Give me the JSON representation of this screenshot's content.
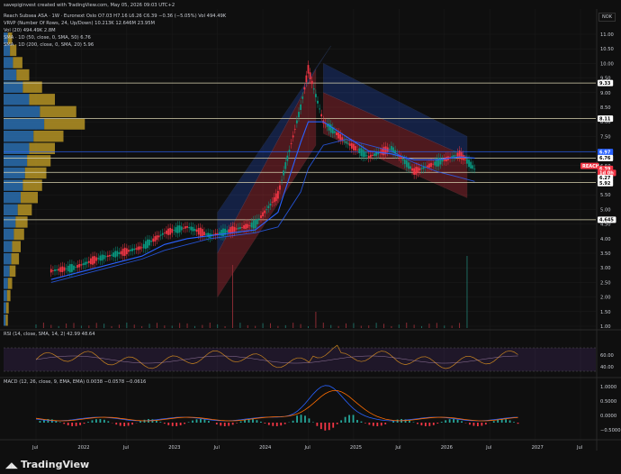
{
  "header": {
    "credit": "savepiginvest created with TradingView.com, May 05, 2026 09:03 UTC+2",
    "line1": "Reach Subsea ASA · 1W · Euronext Oslo  O7.03  H7.16  L6.26  C6.39  −0.36 (−5.05%)  Vol 494.49K",
    "line2": "VRVP (Number Of Rows, 24, Up/Down)  10.213K  12.646M  23.95M",
    "line3": "Vol (20)  494.49K  2.8M",
    "line4": "SMA · 1D (50, close, 0, SMA, 50)  6.76",
    "line5": "SMA · 1D (200, close, 0, SMA, 20)  5.96",
    "currency": "NOK"
  },
  "price_axis_ticks": [
    "11.00",
    "10.50",
    "10.00",
    "9.50",
    "9.00",
    "8.50",
    "8.00",
    "7.50",
    "7.00",
    "6.50",
    "6.00",
    "5.50",
    "5.00",
    "4.50",
    "4.00",
    "3.50",
    "3.00",
    "2.50",
    "2.00",
    "1.50",
    "1.00"
  ],
  "price_labels": [
    {
      "text": "9.33",
      "bg": "#ffffff",
      "fg": "#000000",
      "value": 9.33
    },
    {
      "text": "8.11",
      "bg": "#ffffff",
      "fg": "#000000",
      "value": 8.11
    },
    {
      "text": "6.97",
      "bg": "#2962ff",
      "fg": "#ffffff",
      "value": 6.97
    },
    {
      "text": "6.76",
      "bg": "#ffffff",
      "fg": "#000000",
      "value": 6.76
    },
    {
      "text": "REACH",
      "bg": "#f23645",
      "fg": "#ffffff",
      "value": 6.49
    },
    {
      "text": "6.39",
      "bg": "#f23645",
      "fg": "#ffffff",
      "value": 6.39
    },
    {
      "text": "1d 0h",
      "bg": "#f23645",
      "fg": "#ffffff",
      "value": 6.25
    },
    {
      "text": "6.27",
      "bg": "#ffffff",
      "fg": "#000000",
      "value": 6.08
    },
    {
      "text": "5.92",
      "bg": "#ffffff",
      "fg": "#000000",
      "value": 5.9
    },
    {
      "text": "4.645",
      "bg": "#ffffff",
      "fg": "#000000",
      "value": 4.645
    }
  ],
  "rsi": {
    "title": "RSI (14, close, SMA, 14, 2)  42.99  48.64",
    "ticks": [
      "60.00",
      "40.00"
    ]
  },
  "macd": {
    "title": "MACD (12, 26, close, 9, EMA, EMA)  0.0038  −0.0578  −0.0616",
    "ticks": [
      "1.0000",
      "0.5000",
      "0.0000",
      "−0.5000"
    ]
  },
  "time_axis": [
    "Jul",
    "2022",
    "Jul",
    "2023",
    "Jul",
    "2024",
    "Jul",
    "2025",
    "Jul",
    "2026",
    "Jul",
    "2027",
    "Jul"
  ],
  "footer": {
    "brand": "TradingView"
  },
  "chart_data": {
    "type": "line",
    "series": [
      {
        "name": "Reach Subsea ASA",
        "x": [
          "2021-09",
          "2021-12",
          "2022-03",
          "2022-06",
          "2022-09",
          "2022-12",
          "2023-03",
          "2023-06",
          "2023-09",
          "2023-12",
          "2024-03",
          "2024-06",
          "2024-07",
          "2024-09",
          "2024-12",
          "2025-03",
          "2025-06",
          "2025-09",
          "2025-12",
          "2026-03",
          "2026-05"
        ],
        "y": [
          2.9,
          3.0,
          3.3,
          3.5,
          3.7,
          4.2,
          4.4,
          4.1,
          4.3,
          4.5,
          5.5,
          8.5,
          9.8,
          8.0,
          7.3,
          6.8,
          7.1,
          6.3,
          6.6,
          6.9,
          6.39
        ]
      },
      {
        "name": "SMA 50",
        "y": [
          2.6,
          2.8,
          3.0,
          3.2,
          3.4,
          3.8,
          4.0,
          4.1,
          4.2,
          4.3,
          4.9,
          7.3,
          8.0,
          8.0,
          7.5,
          7.0,
          6.9,
          6.7,
          6.7,
          6.8,
          6.76
        ]
      },
      {
        "name": "SMA 200",
        "y": [
          2.5,
          2.7,
          2.9,
          3.1,
          3.3,
          3.6,
          3.8,
          4.0,
          4.1,
          4.2,
          4.4,
          5.6,
          6.4,
          7.2,
          7.4,
          7.2,
          7.0,
          6.6,
          6.3,
          6.1,
          5.96
        ]
      }
    ],
    "horizontal_levels": [
      9.33,
      8.11,
      6.97,
      6.76,
      6.27,
      5.92,
      4.645
    ],
    "ylim": [
      1.0,
      11.0
    ],
    "ytick_labels": [
      "11.00",
      "10.50",
      "10.00",
      "9.50",
      "9.00",
      "8.50",
      "8.00",
      "7.50",
      "7.00",
      "6.50",
      "6.00",
      "5.50",
      "5.00",
      "4.50",
      "4.00",
      "3.50",
      "3.00",
      "2.50",
      "2.00",
      "1.50",
      "1.00"
    ],
    "xtick_labels": [
      "Jul",
      "2022",
      "Jul",
      "2023",
      "Jul",
      "2024",
      "Jul",
      "2025",
      "Jul",
      "2026",
      "Jul",
      "2027",
      "Jul"
    ],
    "colors": {
      "up": "#089981",
      "down": "#f23645",
      "sma50": "#2962ff",
      "sma200": "#2962ff",
      "level": "#e0c070",
      "channel_up": "#2962ff",
      "channel_down": "#f23645"
    },
    "grid": true
  }
}
